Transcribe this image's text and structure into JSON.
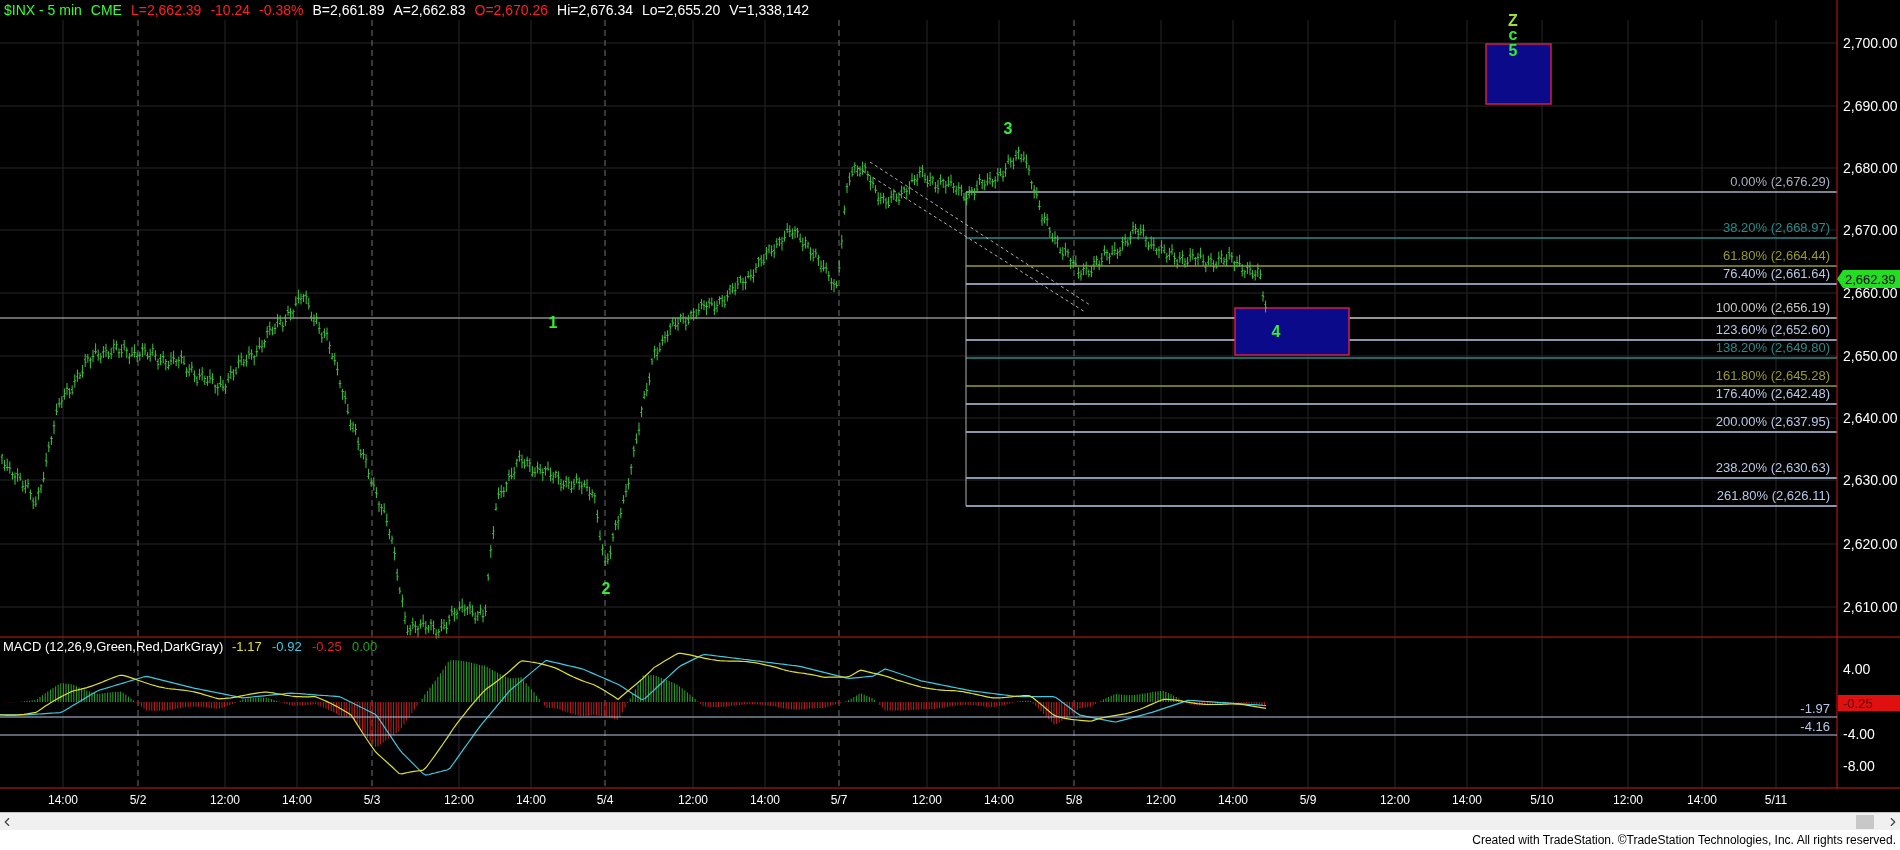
{
  "header": {
    "items": [
      {
        "text": "$INX - 5 min",
        "color": "#33ff33"
      },
      {
        "text": "CME",
        "color": "#33ff33"
      },
      {
        "text": "L=2,662.39",
        "color": "#ff2020"
      },
      {
        "text": "-10.24",
        "color": "#ff2020"
      },
      {
        "text": "-0.38%",
        "color": "#ff2020"
      },
      {
        "text": "B=2,661.89",
        "color": "#ffffff"
      },
      {
        "text": "A=2,662.83",
        "color": "#ffffff"
      },
      {
        "text": "O=2,670.26",
        "color": "#ff2020"
      },
      {
        "text": "Hi=2,676.34",
        "color": "#ffffff"
      },
      {
        "text": "Lo=2,655.20",
        "color": "#ffffff"
      },
      {
        "text": "V=1,338,142",
        "color": "#ffffff"
      }
    ]
  },
  "price_axis": {
    "labels": [
      "2,700.00",
      "2,690.00",
      "2,680.00",
      "2,670.00",
      "2,660.00",
      "2,650.00",
      "2,640.00",
      "2,630.00",
      "2,620.00",
      "2,610.00"
    ],
    "last_price": "2,662.39"
  },
  "fib_levels": [
    {
      "label": "0.00% (2,676.29)",
      "color": "#a8b0c0"
    },
    {
      "label": "38.20% (2,668.97)",
      "color": "#2a8a8a"
    },
    {
      "label": "61.80% (2,664.44)",
      "color": "#9a9a30"
    },
    {
      "label": "76.40% (2,661.64)",
      "color": "#b8c8e8"
    },
    {
      "label": "100.00% (2,656.19)",
      "color": "#c8c8c8"
    },
    {
      "label": "123.60% (2,652.60)",
      "color": "#b8c8e8"
    },
    {
      "label": "138.20% (2,649.80)",
      "color": "#2a8a8a"
    },
    {
      "label": "161.80% (2,645.28)",
      "color": "#9a9a30"
    },
    {
      "label": "176.40% (2,642.48)",
      "color": "#b8c8e8"
    },
    {
      "label": "200.00% (2,637.95)",
      "color": "#b8c8e8"
    },
    {
      "label": "238.20% (2,630.63)",
      "color": "#b8c8e8"
    },
    {
      "label": "261.80% (2,626.11)",
      "color": "#b8c8e8"
    }
  ],
  "wave_labels": [
    {
      "text": "1"
    },
    {
      "text": "2"
    },
    {
      "text": "3"
    },
    {
      "text": "4"
    },
    {
      "text": "Z"
    },
    {
      "text": "c"
    },
    {
      "text": "5"
    }
  ],
  "macd": {
    "title": "MACD (12,26,9,Green,Red,DarkGray)",
    "values": [
      {
        "text": "-1.17",
        "color": "#e0e030"
      },
      {
        "text": "-0.92",
        "color": "#40c8e0"
      },
      {
        "text": "-0.25",
        "color": "#e02020"
      },
      {
        "text": "0.00",
        "color": "#20a020"
      }
    ],
    "levels": [
      "-1.97",
      "-4.16"
    ],
    "axis_labels": [
      "4.00",
      "-4.00",
      "-8.00"
    ],
    "last_value": "-0.25"
  },
  "time_axis": {
    "labels": [
      "14:00",
      "5/2",
      "12:00",
      "14:00",
      "5/3",
      "12:00",
      "14:00",
      "5/4",
      "12:00",
      "14:00",
      "5/7",
      "12:00",
      "14:00",
      "5/8",
      "12:00",
      "14:00",
      "5/9",
      "12:00",
      "14:00",
      "5/10",
      "12:00",
      "14:00",
      "5/11"
    ]
  },
  "footer": {
    "credit": "Created with TradeStation. ©TradeStation Technologies, Inc. All rights reserved."
  }
}
